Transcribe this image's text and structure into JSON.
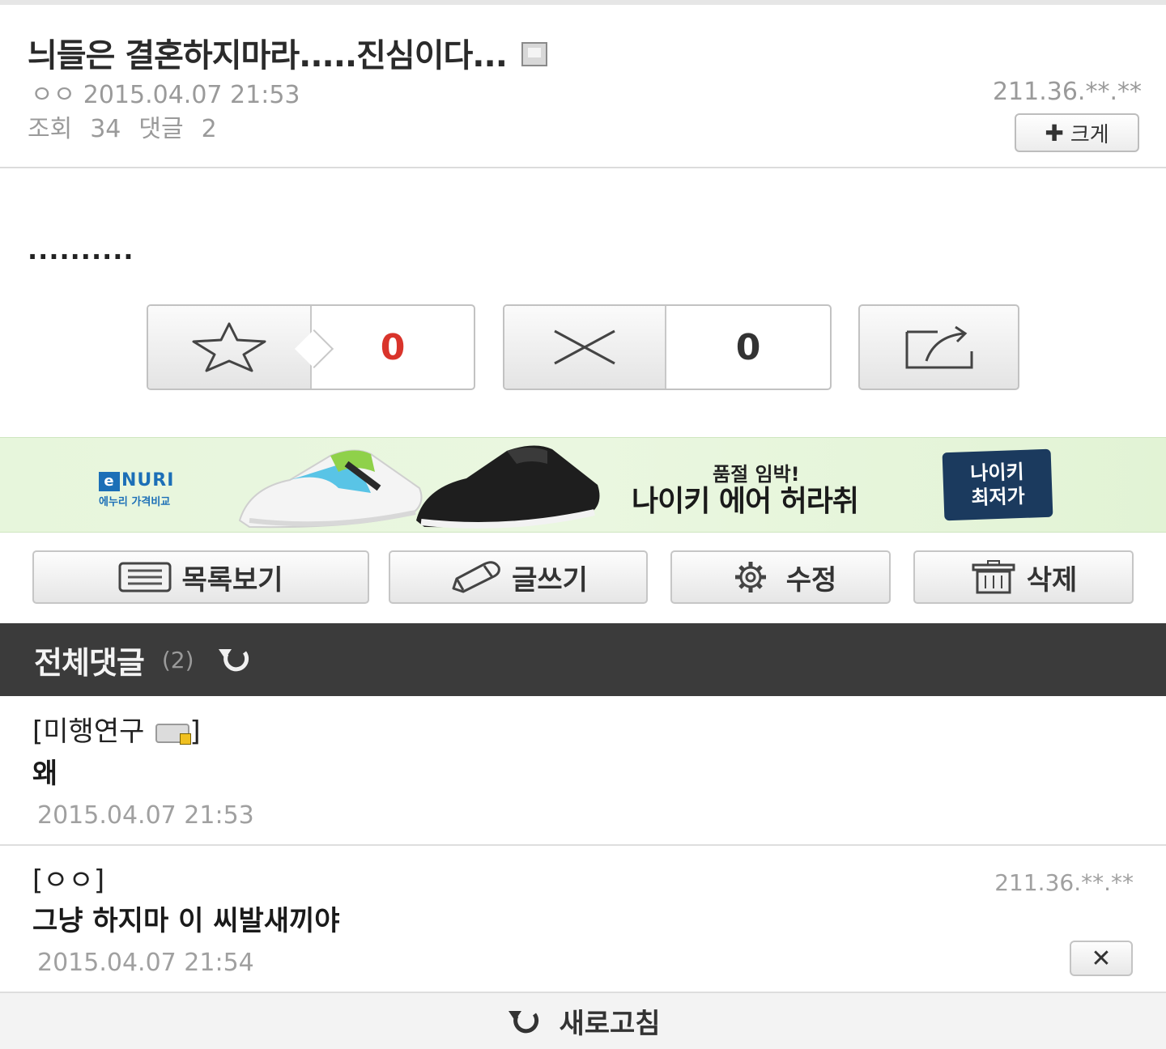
{
  "post": {
    "title": "늬들은 결혼하지마라.....진심이다...",
    "author": "ㅇㅇ",
    "datetime": "2015.04.07 21:53",
    "views_label": "조회",
    "views": "34",
    "comments_label": "댓글",
    "comments": "2",
    "ip": "211.36.**.**",
    "bigger_label": "크게",
    "body": "..........",
    "icons": {
      "title_icon": "mobile-icon",
      "plus": "plus-icon"
    }
  },
  "votes": {
    "recommend_count": "0",
    "dislike_count": "0",
    "recommend_count_color": "#d9342b",
    "icons": [
      "star-icon",
      "x-icon",
      "share-icon"
    ]
  },
  "ad": {
    "brand": "NURI",
    "brand_badge": "e",
    "brand_sub": "에누리 가격비교",
    "subtitle": "품절 임박!",
    "headline": "나이키 에어 허라취",
    "badge_line1": "나이키",
    "badge_line2": "최저가"
  },
  "actions": {
    "list": "목록보기",
    "write": "글쓰기",
    "edit": "수정",
    "delete": "삭제",
    "icons": [
      "list-icon",
      "pencil-icon",
      "gear-icon",
      "trash-icon"
    ]
  },
  "comments_section": {
    "label": "전체댓글",
    "count": "(2)",
    "items": [
      {
        "author": "[미행연구",
        "author_suffix": "]",
        "text": "왜",
        "date": "2015.04.07 21:53"
      },
      {
        "author": "[ㅇㅇ]",
        "text": "그냥 하지마 이 씨발새끼야",
        "date": "2015.04.07 21:54",
        "ip": "211.36.**.**",
        "delete_label": "✕"
      }
    ]
  },
  "footer": {
    "refresh_label": "새로고침"
  },
  "colors": {
    "comment_header_bg": "#3b3b3b",
    "ad_badge_bg": "#1b3a5e",
    "enuri_blue": "#1c6fb7"
  }
}
